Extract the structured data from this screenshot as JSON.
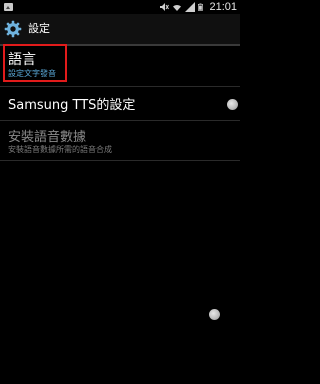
{
  "status_bar": {
    "time": "21:01",
    "icons": [
      "image-icon",
      "mute-icon",
      "wifi-icon",
      "signal-icon",
      "battery-icon"
    ]
  },
  "action_bar": {
    "icon": "gear-icon",
    "title": "設定"
  },
  "list": {
    "items": [
      {
        "title": "語言",
        "subtitle": "設定文字發音"
      },
      {
        "title": "Samsung TTS的設定",
        "subtitle": ""
      },
      {
        "title": "安裝語音數據",
        "subtitle": "安裝語音數據所需的語音合成"
      }
    ]
  },
  "colors": {
    "background": "#000000",
    "highlight": "#e21b1b",
    "subtitle": "#5aa9d8"
  }
}
